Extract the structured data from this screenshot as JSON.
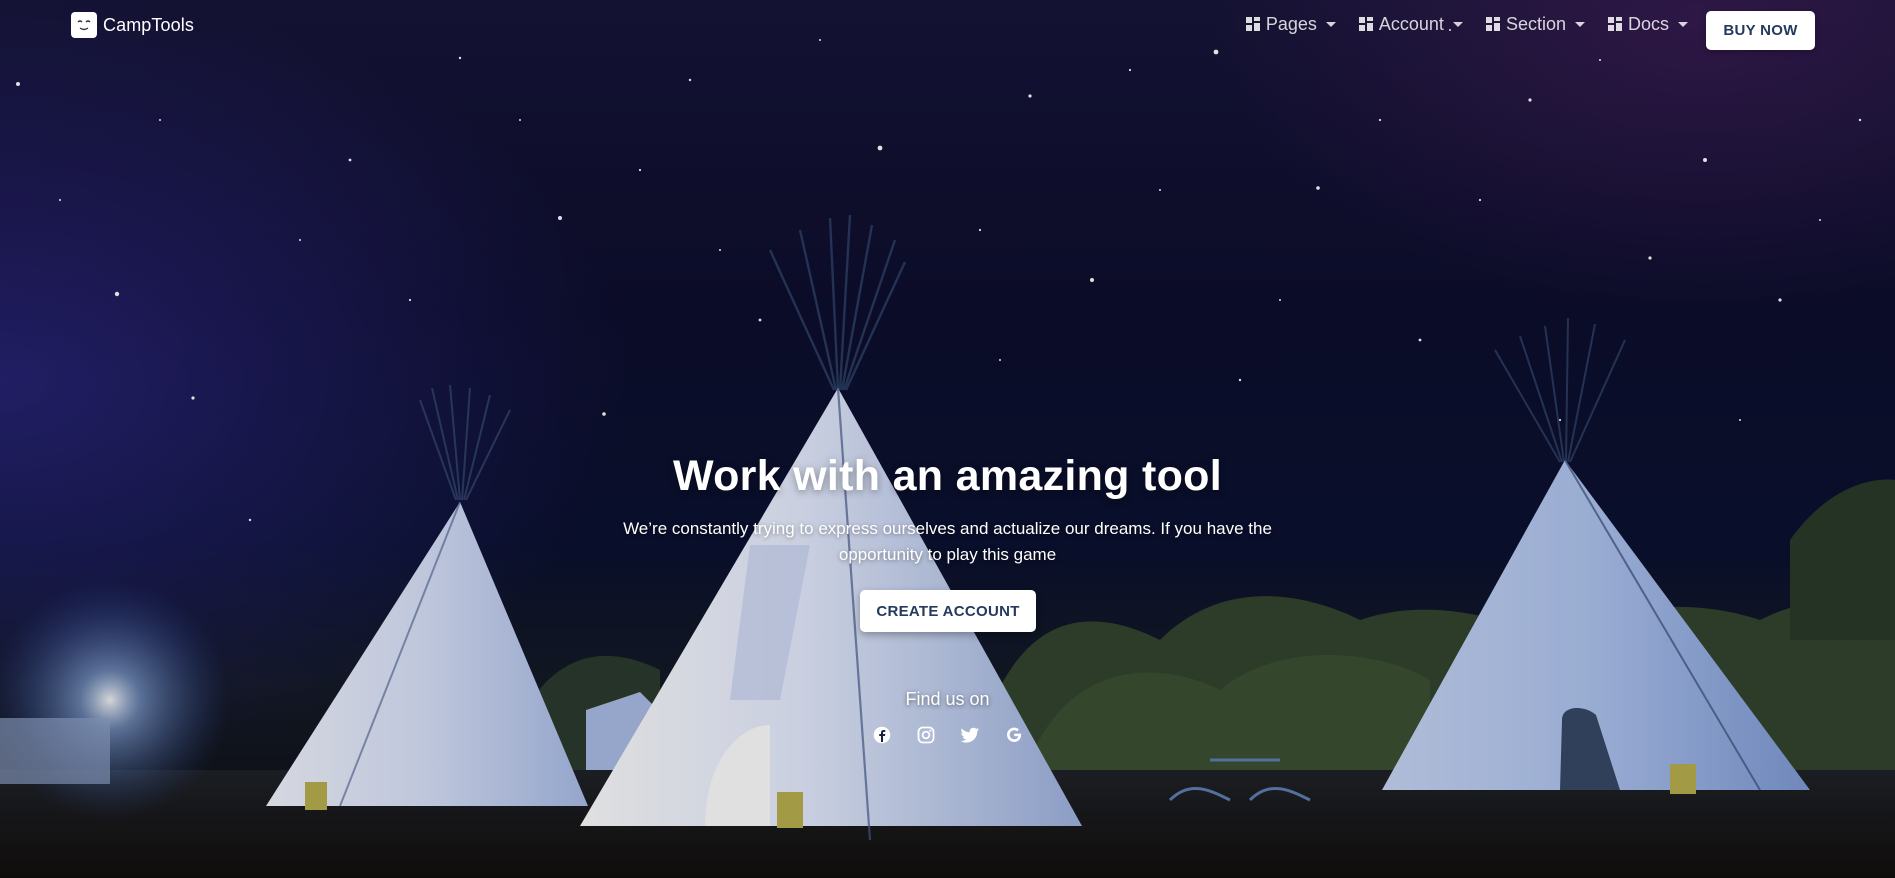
{
  "brand": {
    "name": "CampTools"
  },
  "nav": {
    "items": [
      {
        "label": "Pages",
        "icon": "grid-icon"
      },
      {
        "label": "Account",
        "icon": "grid-icon"
      },
      {
        "label": "Section",
        "icon": "grid-icon"
      },
      {
        "label": "Docs",
        "icon": "grid-icon"
      }
    ],
    "buy_label": "BUY NOW"
  },
  "hero": {
    "title": "Work with an amazing tool",
    "description": "We’re constantly trying to express ourselves and actualize our dreams. If you have the opportunity to play this game",
    "cta_label": "CREATE ACCOUNT",
    "find_us": "Find us on",
    "social": [
      "facebook-icon",
      "instagram-icon",
      "twitter-icon",
      "google-icon"
    ]
  },
  "colors": {
    "button_text": "#243a5e",
    "button_bg": "#ffffff",
    "sky_dark": "#0d0e2e",
    "tent": "#c8d6f5"
  }
}
